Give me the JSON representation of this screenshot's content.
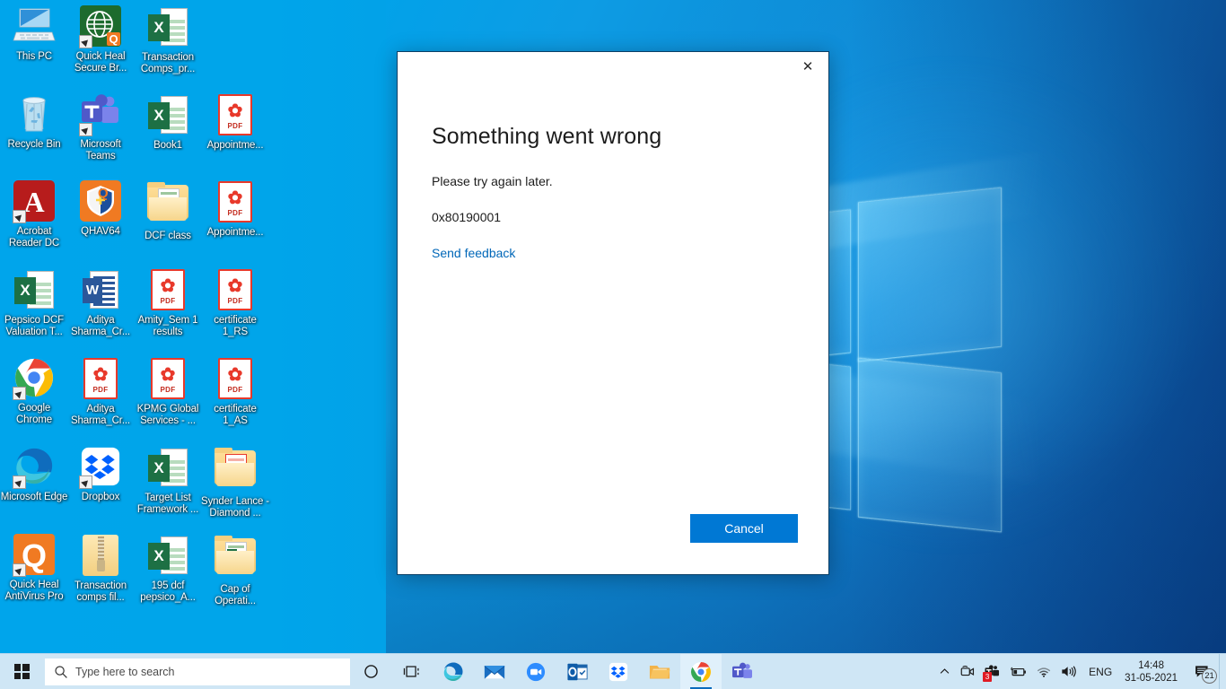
{
  "desktop": {
    "icons": [
      {
        "label": "This PC",
        "type": "computer-icon",
        "shortcut": false,
        "col": 0,
        "row": 0
      },
      {
        "label": "Quick Heal Secure Br...",
        "type": "quickheal-browser-icon",
        "shortcut": true,
        "col": 1,
        "row": 0
      },
      {
        "label": "Transaction Comps_pr...",
        "type": "excel-file-icon",
        "shortcut": false,
        "col": 2,
        "row": 0
      },
      {
        "label": "Recycle Bin",
        "type": "recycle-bin-icon",
        "shortcut": false,
        "col": 0,
        "row": 1
      },
      {
        "label": "Microsoft Teams",
        "type": "teams-icon",
        "shortcut": true,
        "col": 1,
        "row": 1
      },
      {
        "label": "Book1",
        "type": "excel-file-icon",
        "shortcut": false,
        "col": 2,
        "row": 1
      },
      {
        "label": "Appointme...",
        "type": "pdf-file-icon",
        "shortcut": false,
        "col": 3,
        "row": 1
      },
      {
        "label": "Acrobat Reader DC",
        "type": "acrobat-icon",
        "shortcut": true,
        "col": 0,
        "row": 2
      },
      {
        "label": "QHAV64",
        "type": "quickheal-antivirus-icon",
        "shortcut": false,
        "col": 1,
        "row": 2
      },
      {
        "label": "DCF class",
        "type": "folder-icon",
        "shortcut": false,
        "col": 2,
        "row": 2
      },
      {
        "label": "Appointme...",
        "type": "pdf-file-icon",
        "shortcut": false,
        "col": 3,
        "row": 2
      },
      {
        "label": "Pepsico DCF Valuation T...",
        "type": "excel-file-icon",
        "shortcut": false,
        "col": 0,
        "row": 3
      },
      {
        "label": "Aditya Sharma_Cr...",
        "type": "word-file-icon",
        "shortcut": false,
        "col": 1,
        "row": 3
      },
      {
        "label": "Amity_Sem 1 results",
        "type": "pdf-file-icon",
        "shortcut": false,
        "col": 2,
        "row": 3
      },
      {
        "label": "certificate 1_RS",
        "type": "pdf-file-icon",
        "shortcut": false,
        "col": 3,
        "row": 3
      },
      {
        "label": "Google Chrome",
        "type": "chrome-icon",
        "shortcut": true,
        "col": 0,
        "row": 4
      },
      {
        "label": "Aditya Sharma_Cr...",
        "type": "pdf-file-icon",
        "shortcut": false,
        "col": 1,
        "row": 4
      },
      {
        "label": "KPMG Global Services - ...",
        "type": "pdf-file-icon",
        "shortcut": false,
        "col": 2,
        "row": 4
      },
      {
        "label": "certificate 1_AS",
        "type": "pdf-file-icon",
        "shortcut": false,
        "col": 3,
        "row": 4
      },
      {
        "label": "Microsoft Edge",
        "type": "edge-icon",
        "shortcut": true,
        "col": 0,
        "row": 5
      },
      {
        "label": "Dropbox",
        "type": "dropbox-icon",
        "shortcut": true,
        "col": 1,
        "row": 5
      },
      {
        "label": "Target List Framework ...",
        "type": "excel-file-icon",
        "shortcut": false,
        "col": 2,
        "row": 5
      },
      {
        "label": "Synder Lance - Diamond ...",
        "type": "folder-pdf-icon",
        "shortcut": false,
        "col": 3,
        "row": 5
      },
      {
        "label": "Quick Heal AntiVirus Pro",
        "type": "quickheal-antivirus-pro-icon",
        "shortcut": true,
        "col": 0,
        "row": 6
      },
      {
        "label": "Transaction comps fil...",
        "type": "zip-file-icon",
        "shortcut": false,
        "col": 1,
        "row": 6
      },
      {
        "label": "195 dcf pepsico_A...",
        "type": "excel-file-icon",
        "shortcut": false,
        "col": 2,
        "row": 6
      },
      {
        "label": "Cap of Operati...",
        "type": "folder-excel-icon",
        "shortcut": false,
        "col": 3,
        "row": 6
      }
    ]
  },
  "dialog": {
    "title": "Something went wrong",
    "message": "Please try again later.",
    "error_code": "0x80190001",
    "feedback_link": "Send feedback",
    "cancel_label": "Cancel",
    "close_glyph": "✕",
    "accent_color": "#0078d4",
    "link_color": "#0067b8"
  },
  "taskbar": {
    "start_name": "start-button",
    "search": {
      "placeholder": "Type here to search"
    },
    "buttons": [
      {
        "name": "cortana-button",
        "icon": "cortana-icon",
        "active": false
      },
      {
        "name": "task-view-button",
        "icon": "task-view-icon",
        "active": false
      },
      {
        "name": "microsoft-edge-button",
        "icon": "edge-icon",
        "active": false
      },
      {
        "name": "mail-button",
        "icon": "mail-icon",
        "active": false
      },
      {
        "name": "zoom-button",
        "icon": "zoom-camera-icon",
        "active": false
      },
      {
        "name": "outlook-button",
        "icon": "outlook-icon",
        "active": false
      },
      {
        "name": "dropbox-button",
        "icon": "dropbox-icon",
        "active": false
      },
      {
        "name": "file-explorer-button",
        "icon": "file-explorer-icon",
        "active": false
      },
      {
        "name": "google-chrome-button",
        "icon": "chrome-icon",
        "active": true
      },
      {
        "name": "microsoft-teams-button",
        "icon": "teams-icon",
        "active": false
      }
    ],
    "tray": {
      "chevron": "˄",
      "teams_badge": "3",
      "language": "ENG",
      "time": "14:48",
      "date": "31-05-2021",
      "notification_count": "21"
    }
  }
}
